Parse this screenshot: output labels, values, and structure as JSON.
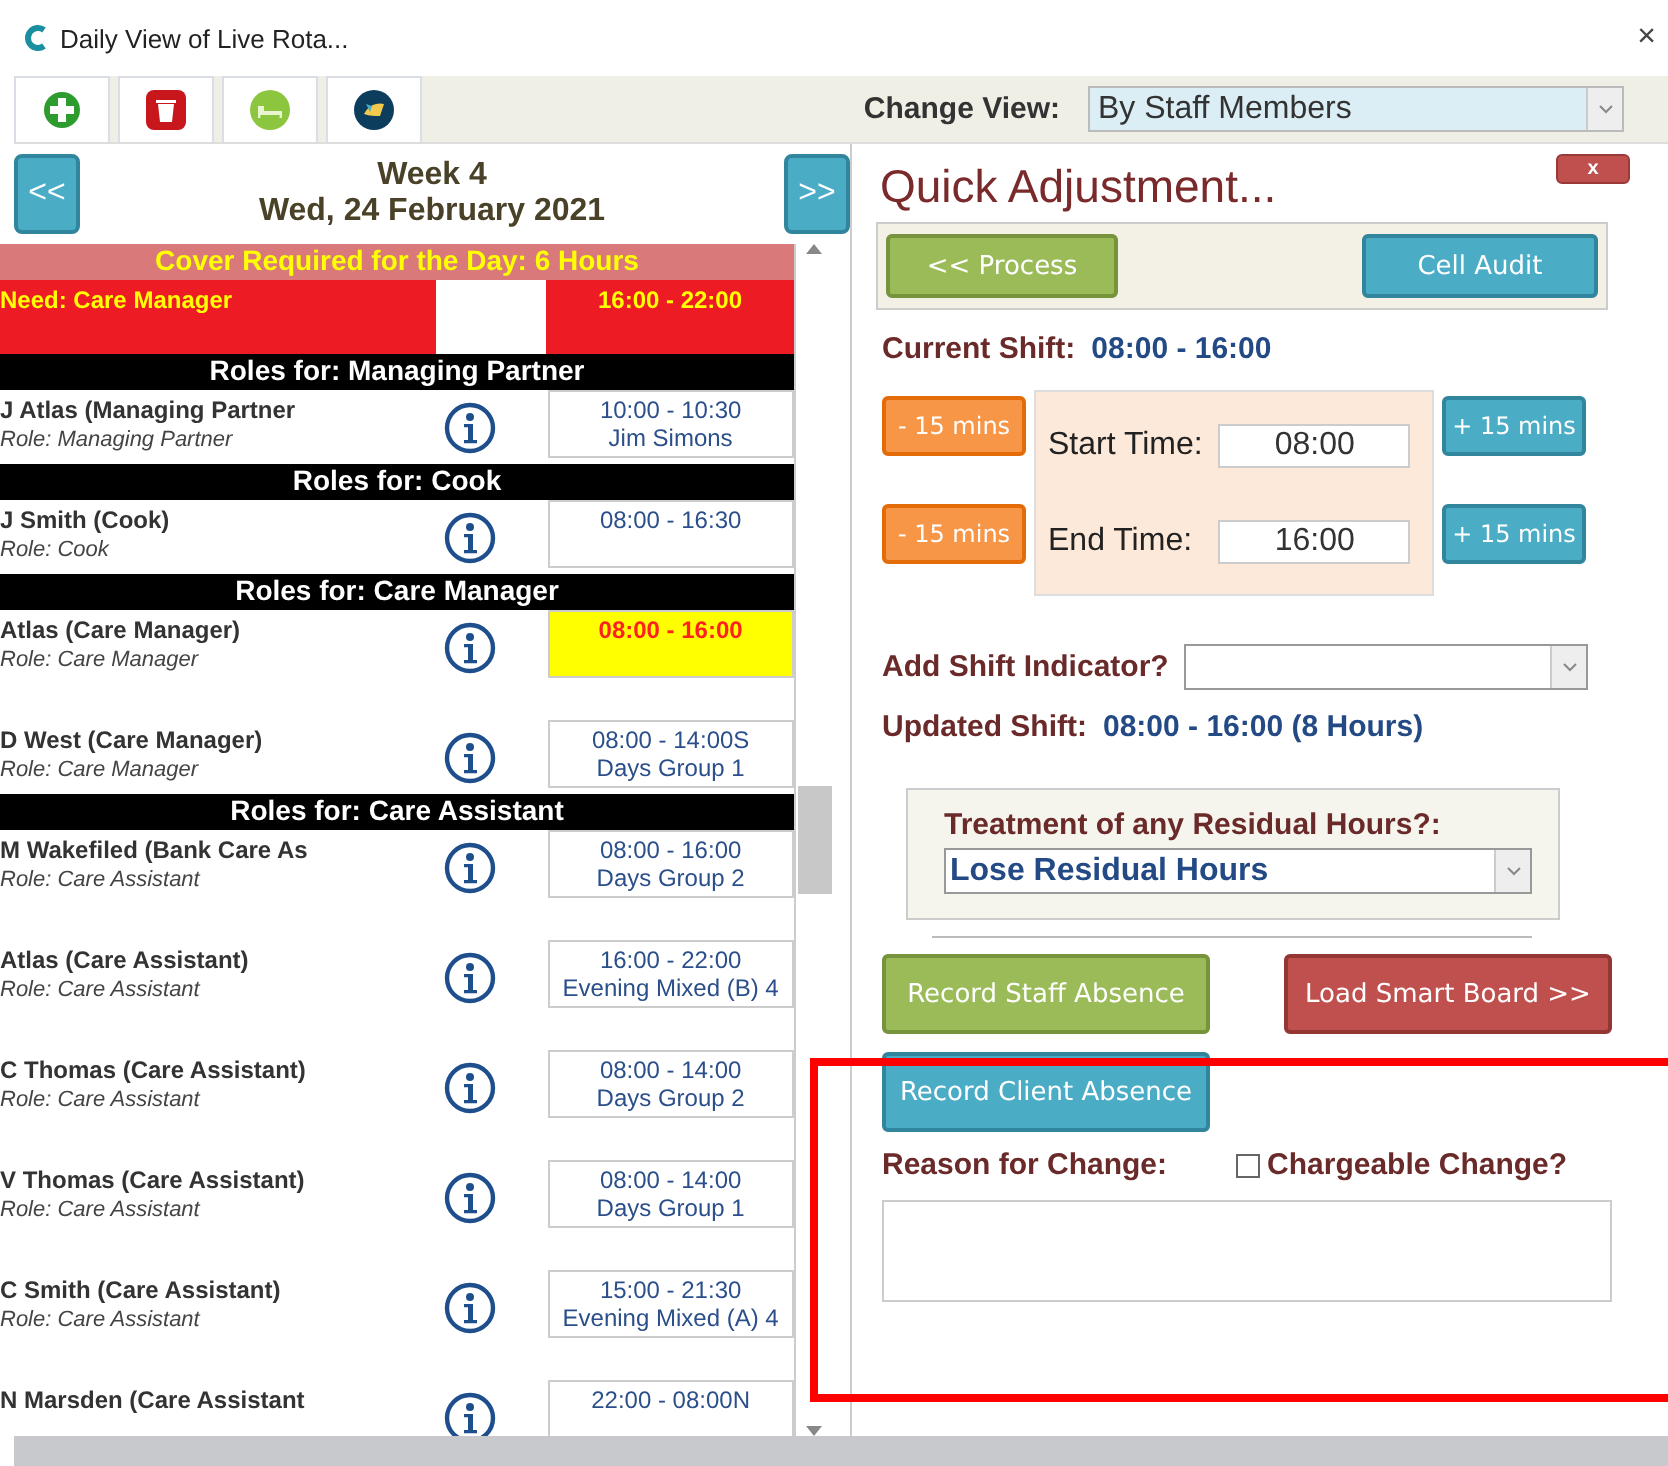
{
  "window": {
    "title": "Daily View of Live Rota...",
    "close": "×"
  },
  "toolbar": {
    "tools": [
      {
        "kind": "add"
      },
      {
        "kind": "delete"
      },
      {
        "kind": "bed"
      },
      {
        "kind": "globe"
      }
    ],
    "change_view_label": "Change View:",
    "change_view_value": "By Staff Members"
  },
  "week": {
    "prev": "<<",
    "next": ">>",
    "title": "Week 4",
    "date": "Wed, 24 February 2021"
  },
  "cover": {
    "title": "Cover Required for the Day: 6 Hours",
    "need": "Need: Care Manager",
    "need_time": "16:00 - 22:00"
  },
  "groups": [
    {
      "title": "Roles for: Managing Partner",
      "rows": [
        {
          "name": "J Atlas (Managing Partner",
          "role": "Role: Managing Partner",
          "time": "10:00 - 10:30",
          "detail": "Jim Simons",
          "selected": false
        }
      ]
    },
    {
      "title": "Roles for: Cook",
      "rows": [
        {
          "name": "J Smith (Cook)",
          "role": "Role: Cook",
          "time": "08:00 - 16:30",
          "selected": false
        }
      ]
    },
    {
      "title": "Roles for: Care Manager",
      "rows": [
        {
          "name": "Atlas (Care Manager)",
          "role": "Role: Care Manager",
          "time": "08:00 - 16:00",
          "selected": true
        },
        {
          "name": "D West (Care Manager)",
          "role": "Role: Care Manager",
          "time": "08:00 - 14:00S",
          "detail": "Days Group 1",
          "selected": false
        }
      ]
    },
    {
      "title": "Roles for: Care Assistant",
      "rows": [
        {
          "name": "M Wakefiled (Bank Care As",
          "role": "Role: Care Assistant",
          "time": "08:00 - 16:00",
          "detail": "Days Group 2",
          "selected": false
        },
        {
          "name": "Atlas (Care Assistant)",
          "role": "Role: Care Assistant",
          "time": "16:00 - 22:00",
          "detail": "Evening Mixed (B) 4",
          "selected": false
        },
        {
          "name": "C Thomas (Care Assistant)",
          "role": "Role: Care Assistant",
          "time": "08:00 - 14:00",
          "detail": "Days Group 2",
          "selected": false
        },
        {
          "name": "V Thomas (Care Assistant)",
          "role": "Role: Care Assistant",
          "time": "08:00 - 14:00",
          "detail": "Days Group 1",
          "selected": false
        },
        {
          "name": "C Smith (Care Assistant)",
          "role": "Role: Care Assistant",
          "time": "15:00 - 21:30",
          "detail": "Evening Mixed (A) 4",
          "selected": false
        },
        {
          "name": "N Marsden (Care Assistant",
          "time": "22:00 - 08:00N",
          "selected": false
        }
      ]
    }
  ],
  "panel": {
    "title": "Quick Adjustment...",
    "close": "x",
    "process": "<< Process",
    "cell_audit": "Cell Audit",
    "current_label": "Current Shift:",
    "current_value": "08:00 - 16:00",
    "minus": [
      "- 15 mins",
      "- 15 mins"
    ],
    "plus": [
      "+ 15 mins",
      "+ 15 mins"
    ],
    "start_label": "Start Time:",
    "start_value": "08:00",
    "end_label": "End Time:",
    "end_value": "16:00",
    "indicator_label": "Add Shift Indicator?",
    "updated_label": "Updated Shift:",
    "updated_value": "08:00 - 16:00 (8 Hours)",
    "residual_label": "Treatment of any Residual Hours?:",
    "residual_value": "Lose Residual Hours",
    "staff_absence": "Record Staff Absence",
    "smart_board": "Load Smart Board >>",
    "client_absence": "Record Client Absence",
    "reason_label": "Reason for Change:",
    "chargeable_label": "Chargeable Change?",
    "chargeable": false
  },
  "annotation": {
    "kind": "rectangle",
    "color": "#ff0000"
  }
}
